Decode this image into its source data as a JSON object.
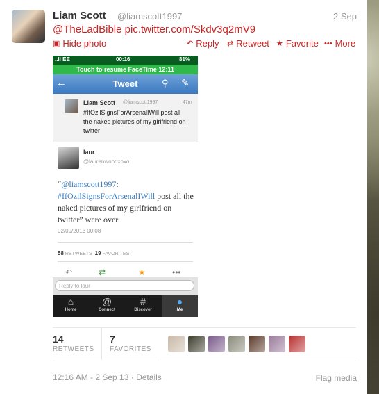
{
  "tweet": {
    "name": "Liam Scott",
    "handle": "@liamscott1997",
    "date": "2 Sep",
    "mention": "@TheLadBible",
    "link": "pic.twitter.com/Skdv3q2mV9"
  },
  "actions": {
    "hide_photo": "Hide photo",
    "reply": "Reply",
    "retweet": "Retweet",
    "favorite": "Favorite",
    "more": "More"
  },
  "screenshot": {
    "status": {
      "carrier": "..ll EE",
      "time": "00:16",
      "battery": "81%"
    },
    "facetime_banner": "Touch to resume FaceTime 12:11",
    "nav_title": "Tweet",
    "quoted": {
      "name": "Liam Scott",
      "handle": "@liamscott1997",
      "time": "47m",
      "text": "#IfOzilSignsForArsenalIWill post all the naked pictures of my girlfriend on twitter"
    },
    "reply_author": {
      "name": "laur",
      "handle": "@laurenwoodxoxo"
    },
    "reply_text": {
      "open_quote": "“",
      "mention": "@liamscott1997",
      "colon": ":",
      "hashtag": "#IfOzilSignsForArsenalIWill",
      "body": " post all the naked pictures of my girlfriend on twitter”  were over"
    },
    "reply_date": "02/09/2013 00:08",
    "retweets": {
      "count": "58",
      "label": "RETWEETS"
    },
    "favorites": {
      "count": "19",
      "label": "FAVORITES"
    },
    "reply_placeholder": "Reply to laur",
    "tabs": [
      {
        "label": "Home",
        "icon": "home-icon"
      },
      {
        "label": "Connect",
        "icon": "at-icon"
      },
      {
        "label": "Discover",
        "icon": "hash-icon"
      },
      {
        "label": "Me",
        "icon": "person-icon"
      }
    ]
  },
  "stats": {
    "retweets_count": "14",
    "retweets_label": "RETWEETS",
    "favorites_count": "7",
    "favorites_label": "FAVORITES"
  },
  "favoriters": [
    {
      "color": "#c9b9a8"
    },
    {
      "color": "#3d3d2d"
    },
    {
      "color": "#7a5a8a"
    },
    {
      "color": "#8a8a7a"
    },
    {
      "color": "#5a3a2a"
    },
    {
      "color": "#9a7a9a"
    },
    {
      "color": "#b83030"
    }
  ],
  "footer": {
    "timestamp": "12:16 AM - 2 Sep 13",
    "separator": "·",
    "details": "Details",
    "flag_media": "Flag media"
  },
  "colors": {
    "accent": "#cc2222",
    "twitter_blue": "#3a78c0",
    "facetime_green": "#31b84a"
  }
}
